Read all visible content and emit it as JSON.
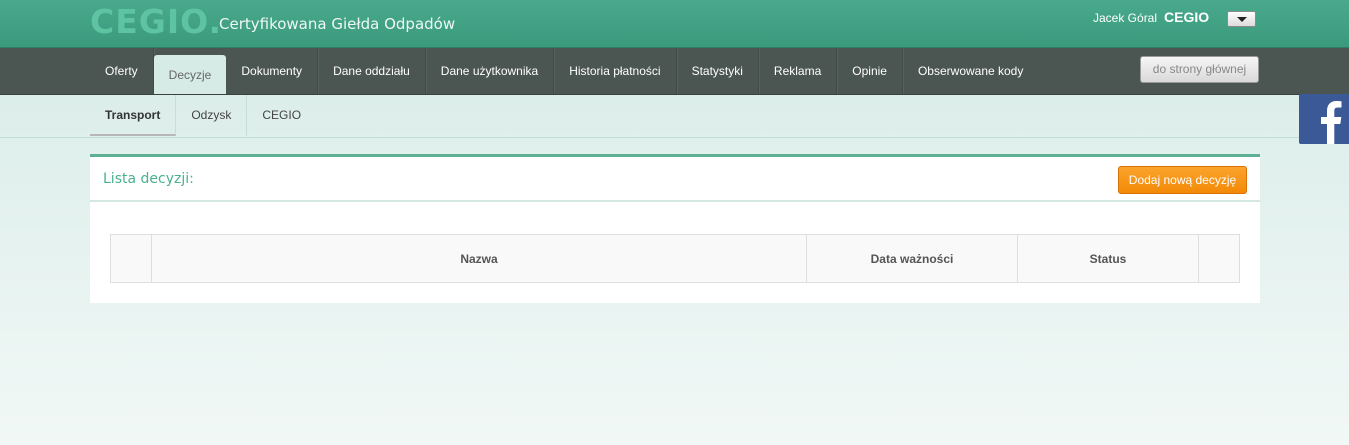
{
  "header": {
    "logo": "CEGIO.",
    "subtitle": "Certyfikowana Giełda Odpadów",
    "user_name": "Jacek Góral",
    "user_company": "CEGIO"
  },
  "mainnav": {
    "items": [
      {
        "label": "Oferty"
      },
      {
        "label": "Decyzje",
        "active": true
      },
      {
        "label": "Dokumenty"
      },
      {
        "label": "Dane oddziału"
      },
      {
        "label": "Dane użytkownika"
      },
      {
        "label": "Historia płatności"
      },
      {
        "label": "Statystyki"
      },
      {
        "label": "Reklama"
      },
      {
        "label": "Opinie"
      },
      {
        "label": "Obserwowane kody"
      }
    ],
    "home_button": "do strony głównej"
  },
  "subnav": {
    "items": [
      {
        "label": "Transport",
        "active": true
      },
      {
        "label": "Odzysk"
      },
      {
        "label": "CEGIO"
      }
    ]
  },
  "social": {
    "icon": "facebook-icon",
    "color": "#3b5997"
  },
  "panel": {
    "title": "Lista decyzji:",
    "add_button": "Dodaj nową decyzję",
    "table": {
      "columns": [
        "",
        "Nazwa",
        "Data ważności",
        "Status",
        ""
      ]
    }
  },
  "colors": {
    "accent_green": "#4bb08f",
    "nav_dark": "#4b5552",
    "button_orange": "#f6931a"
  }
}
